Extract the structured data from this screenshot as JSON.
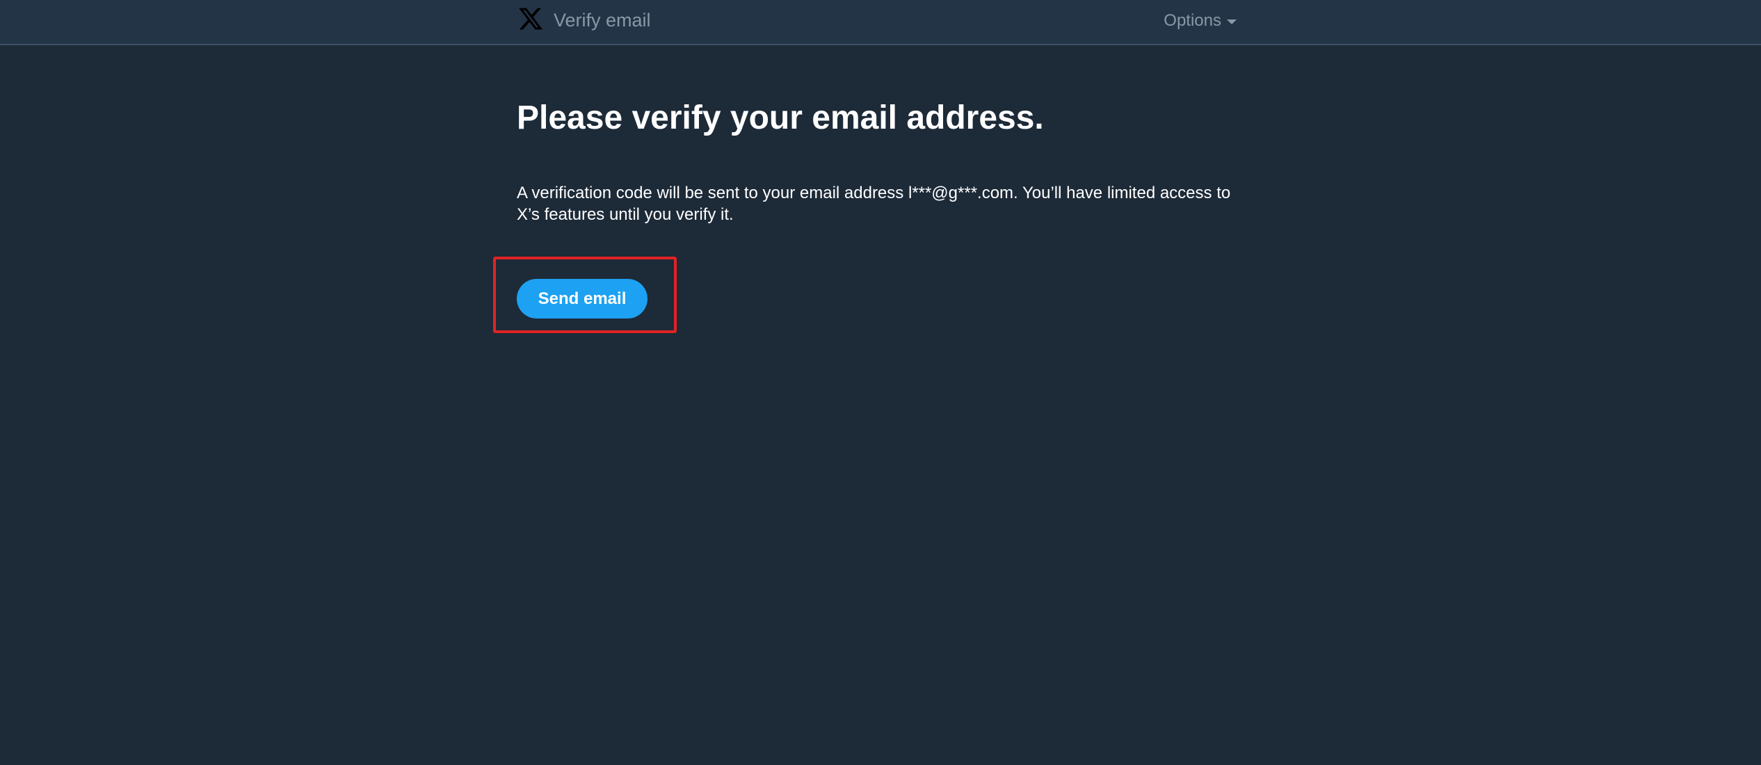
{
  "header": {
    "title": "Verify email",
    "options_label": "Options",
    "logo_icon": "x-logo-icon",
    "options_icon": "caret-down-icon"
  },
  "main": {
    "heading": "Please verify your email address.",
    "description": "A verification code will be sent to your email address l***@g***.com. You’ll have limited access to X’s features until you verify it.",
    "send_button_label": "Send email"
  },
  "colors": {
    "background": "#1d2a38",
    "header_background": "#243447",
    "accent": "#1da1f2",
    "highlight": "#e02424",
    "muted_text": "#8899a6"
  }
}
